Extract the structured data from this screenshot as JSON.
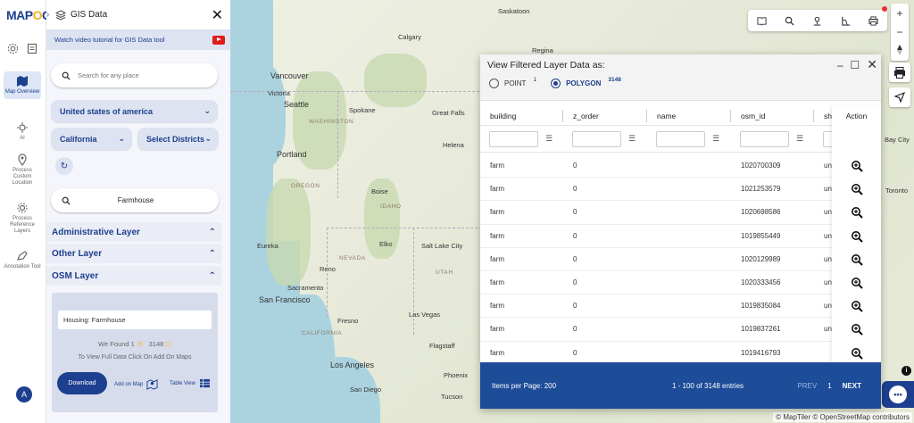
{
  "brand": {
    "logo_text": "MAP",
    "logo_accent": "G",
    "logo_mid": "O"
  },
  "rail": {
    "items": [
      {
        "label": "Map Overview",
        "icon": "map-icon",
        "active": true
      },
      {
        "label": "AI",
        "icon": "ai-icon"
      },
      {
        "label": "Process Custom Location",
        "icon": "location-pin-icon"
      },
      {
        "label": "Process Reference Layers",
        "icon": "layers-gear-icon"
      },
      {
        "label": "Annotation Tool",
        "icon": "annotation-icon"
      }
    ],
    "avatar_initial": "A"
  },
  "panel": {
    "title": "GIS Data",
    "video_text": "Watch video tutorial for GIS Data tool",
    "search_placeholder": "Search for any place",
    "country": "United states of america",
    "state": "California",
    "district_placeholder": "Select Districts",
    "farm_query": "Farmhouse",
    "layers": {
      "administrative": "Administrative Layer",
      "other": "Other Layer",
      "osm": "OSM Layer"
    },
    "osm": {
      "housing": "Housing: Farmhouse",
      "found_prefix": "We Found",
      "found_points": "1",
      "found_polygons": "3148",
      "hint": "To View Full Data Click On Add On Maps",
      "download": "Download",
      "add_on_map": "Add on Map",
      "table_view": "Table View"
    }
  },
  "map": {
    "cities": [
      "Saskatoon",
      "Calgary",
      "Regina",
      "Vancouver",
      "Victoria",
      "Seattle",
      "Spokane",
      "Great Falls",
      "Helena",
      "Portland",
      "Boise",
      "Eureka",
      "Reno",
      "Elko",
      "Salt Lake City",
      "Sacramento",
      "San Francisco",
      "Fresno",
      "Las Vegas",
      "Flagstaff",
      "Los Angeles",
      "San Diego",
      "Phoenix",
      "Tucson",
      "Toronto",
      "Bay City"
    ],
    "states": [
      "WASHINGTON",
      "OREGON",
      "IDAHO",
      "NEVADA",
      "CALIFORNIA",
      "UTAH"
    ],
    "attribution": "© MapTiler © OpenStreetMap contributors"
  },
  "popup": {
    "title": "View Filtered Layer Data as:",
    "point_label": "POINT",
    "point_count": "1",
    "polygon_label": "POLYGON",
    "polygon_count": "3148",
    "columns": [
      "building",
      "z_order",
      "name",
      "osm_id",
      "sh"
    ],
    "action_header": "Action",
    "rows": [
      {
        "building": "farm",
        "z_order": "0",
        "name": "",
        "osm_id": "1020700309",
        "sh": "un"
      },
      {
        "building": "farm",
        "z_order": "0",
        "name": "",
        "osm_id": "1021253579",
        "sh": "un"
      },
      {
        "building": "farm",
        "z_order": "0",
        "name": "",
        "osm_id": "1020698586",
        "sh": "un"
      },
      {
        "building": "farm",
        "z_order": "0",
        "name": "",
        "osm_id": "1019855449",
        "sh": "un"
      },
      {
        "building": "farm",
        "z_order": "0",
        "name": "",
        "osm_id": "1020129989",
        "sh": "un"
      },
      {
        "building": "farm",
        "z_order": "0",
        "name": "",
        "osm_id": "1020333456",
        "sh": "un"
      },
      {
        "building": "farm",
        "z_order": "0",
        "name": "",
        "osm_id": "1019835084",
        "sh": "un"
      },
      {
        "building": "farm",
        "z_order": "0",
        "name": "",
        "osm_id": "1019837261",
        "sh": "un"
      },
      {
        "building": "farm",
        "z_order": "0",
        "name": "",
        "osm_id": "1019416793",
        "sh": ""
      }
    ],
    "items_per_page": "Items per Page: 200",
    "entries": "1 - 100 of 3148 entries",
    "prev": "PREV",
    "page": "1",
    "next": "NEXT"
  },
  "colors": {
    "brand": "#1d3f8f",
    "accent": "#f2b11a",
    "footer": "#1d4c99",
    "alert": "#e01b1b"
  }
}
